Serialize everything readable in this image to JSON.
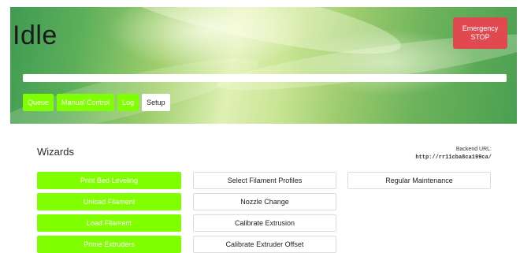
{
  "header": {
    "status": "Idle",
    "emergency_stop": {
      "line1": "Emergency",
      "line2": "STOP"
    },
    "progress": 0
  },
  "tabs": [
    {
      "label": "Queue",
      "active": false
    },
    {
      "label": "Manual Control",
      "active": false
    },
    {
      "label": "Log",
      "active": false
    },
    {
      "label": "Setup",
      "active": true
    }
  ],
  "wizards": {
    "title": "Wizards",
    "backend_label": "Backend URL:",
    "backend_url": "http://rr11cba8ca199ca/",
    "column1": [
      "Print Bed Leveling",
      "Unload Filament",
      "Load Filament",
      "Prime Extruders"
    ],
    "column2": [
      "Select Filament Profiles",
      "Nozzle Change",
      "Calibrate Extrusion",
      "Calibrate Extruder Offset"
    ],
    "column3": [
      "Regular Maintenance"
    ]
  },
  "colors": {
    "accent": "#7fff00",
    "emergency": "#e0494f"
  }
}
